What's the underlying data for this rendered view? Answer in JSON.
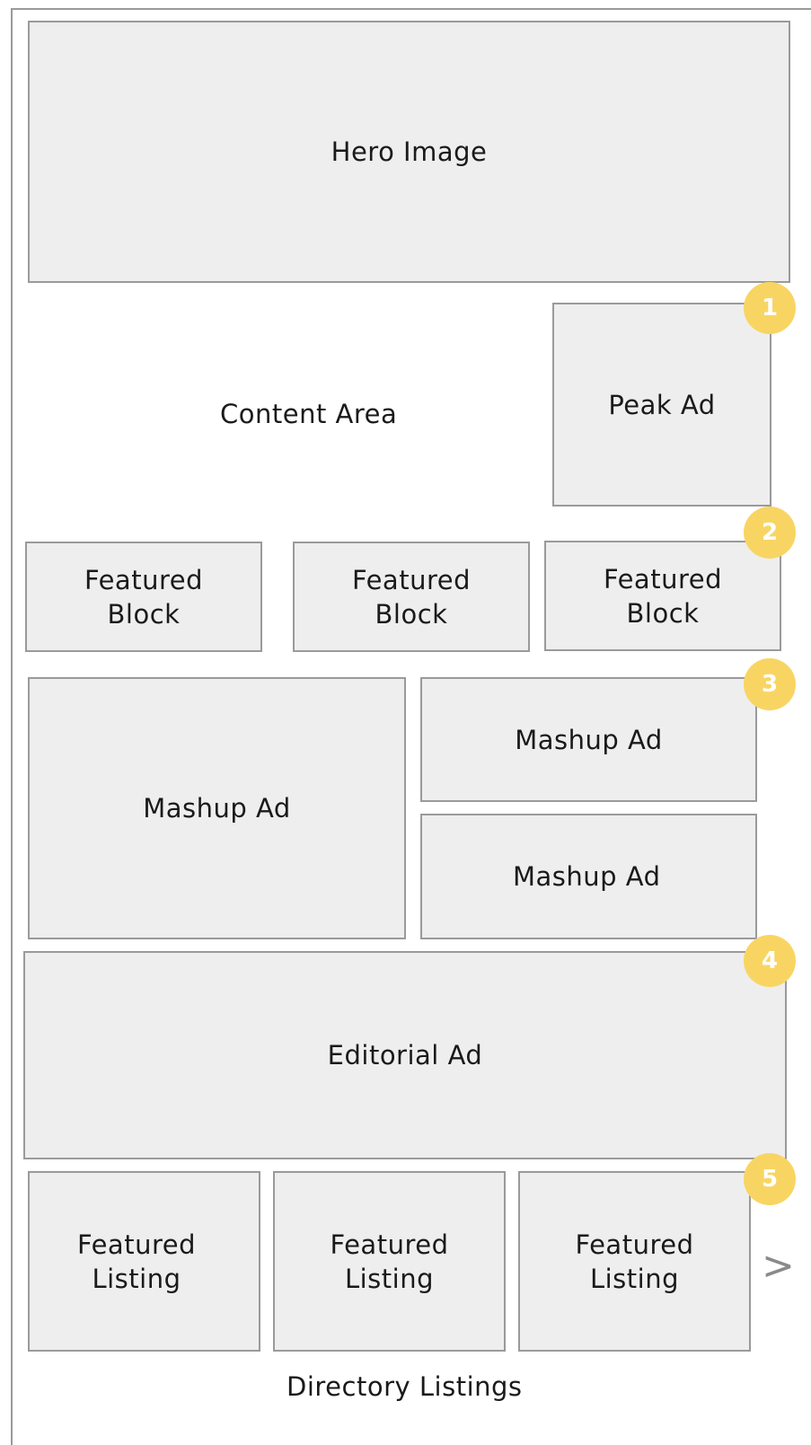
{
  "hero": {
    "label": "Hero Image"
  },
  "content_area": {
    "label": "Content Area"
  },
  "peak_ad": {
    "label": "Peak Ad"
  },
  "featured_blocks": [
    "Featured\nBlock",
    "Featured\nBlock",
    "Featured\nBlock"
  ],
  "mashup_ads": [
    "Mashup Ad",
    "Mashup Ad",
    "Mashup Ad"
  ],
  "editorial_ad": {
    "label": "Editorial Ad"
  },
  "featured_listings": [
    "Featured\nListing",
    "Featured\nListing",
    "Featured\nListing"
  ],
  "next_arrow": ">",
  "footer": {
    "label": "Directory Listings"
  },
  "badges": [
    "1",
    "2",
    "3",
    "4",
    "5"
  ],
  "colors": {
    "badge": "#f8d563",
    "box_fill": "#eeeeee",
    "box_border": "#9a9a9a"
  }
}
